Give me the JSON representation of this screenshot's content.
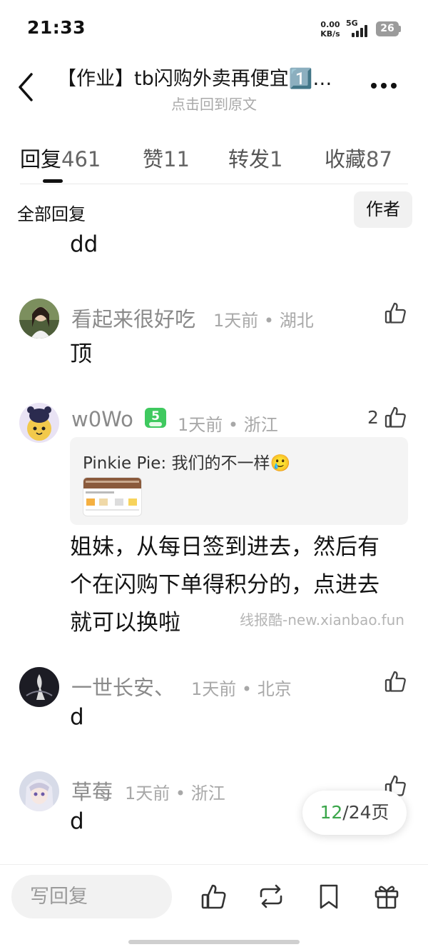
{
  "status_bar": {
    "time": "21:33",
    "net_speed": "0.00",
    "net_unit": "KB/s",
    "network": "5G",
    "battery": "26"
  },
  "header": {
    "title": "【作业】tb闪购外卖再便宜1️⃣…",
    "subtitle": "点击回到原文"
  },
  "tabs": [
    {
      "label": "回复",
      "count": "461",
      "active": true
    },
    {
      "label": "赞",
      "count": "11",
      "active": false
    },
    {
      "label": "转发",
      "count": "1",
      "active": false
    },
    {
      "label": "收藏",
      "count": "87",
      "active": false
    }
  ],
  "filter": {
    "all_replies": "全部回复",
    "author_only": "作者"
  },
  "partial_comment": {
    "text": "dd"
  },
  "comments": [
    {
      "username": "看起来很好吃",
      "time": "1天前",
      "location": "湖北",
      "text": "顶",
      "likes": ""
    },
    {
      "username": "w0Wo",
      "level": "5",
      "time": "1天前",
      "location": "浙江",
      "likes": "2",
      "quote": {
        "author": "Pinkie Pie",
        "text": "我们的不一样🥲"
      },
      "text_lines": [
        "姐妹，从每日签到进去，然后有",
        "个在闪购下单得积分的，点进去",
        "就可以换啦"
      ]
    },
    {
      "username": "一世长安、",
      "time": "1天前",
      "location": "北京",
      "text": "d",
      "likes": ""
    },
    {
      "username": "草莓",
      "time": "1天前",
      "location": "浙江",
      "text": "d",
      "likes": ""
    }
  ],
  "watermark": "线报酷-new.xianbao.fun",
  "pager": {
    "current": "12",
    "total": "/24页"
  },
  "bottom_bar": {
    "reply_placeholder": "写回复"
  },
  "colors": {
    "accent_green": "#3aa64a",
    "level_badge": "#3fc95f"
  }
}
